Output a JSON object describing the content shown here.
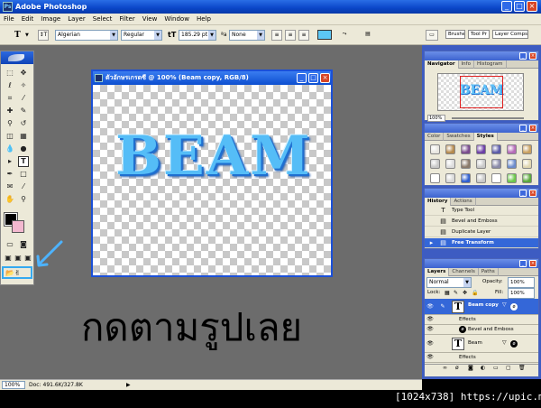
{
  "app": {
    "title": "Adobe Photoshop"
  },
  "menu": [
    "File",
    "Edit",
    "Image",
    "Layer",
    "Select",
    "Filter",
    "View",
    "Window",
    "Help"
  ],
  "options": {
    "tool_glyph": "T",
    "font_family": "Algerian",
    "font_style": "Regular",
    "font_size": "185.29 pt",
    "antialias": "None",
    "text_color": "#5cc7f6",
    "palette_wells": [
      "Brushes",
      "Tool Pr",
      "Layer Comps"
    ]
  },
  "document": {
    "title": "ตัวอักษรเกรดซี @ 100% (Beam copy, RGB/8)",
    "canvas_text": "BEAM"
  },
  "caption": "กดตามรูปเลย",
  "status": {
    "zoom": "100%",
    "doc": "Doc: 491.6K/327.8K",
    "arrow": "▶"
  },
  "navigator": {
    "tabs": [
      "Navigator",
      "Info",
      "Histogram"
    ],
    "thumb_text": "BEAM",
    "zoom": "100%"
  },
  "styles_panel": {
    "tabs": [
      "Color",
      "Swatches",
      "Styles"
    ],
    "swatch_colors": [
      "#e8e6e0",
      "#b58a4e",
      "#7a4b8e",
      "#6c3fa6",
      "#5b5ba8",
      "#b56bb8",
      "#c8a060",
      "#c8c8c8",
      "#dcdcdc",
      "#8a7a6a",
      "#c9c9c9",
      "#8a8aa8",
      "#6c8ccc",
      "#e0d6b0",
      "#ffffff",
      "#d8d8d8",
      "#2f5fd0",
      "#c8c8c8",
      "#ffffff",
      "#6cc84a",
      "#5aa83a"
    ]
  },
  "history": {
    "tabs": [
      "History",
      "Actions"
    ],
    "items": [
      {
        "label": "Type Tool",
        "icon": "T"
      },
      {
        "label": "Bevel and Emboss",
        "icon": "▤"
      },
      {
        "label": "Duplicate Layer",
        "icon": "▤"
      },
      {
        "label": "Free Transform",
        "icon": "▤"
      }
    ]
  },
  "layers": {
    "tabs": [
      "Layers",
      "Channels",
      "Paths"
    ],
    "blend_mode": "Normal",
    "opacity_label": "Opacity:",
    "opacity": "100%",
    "lock_label": "Lock:",
    "fill_label": "Fill:",
    "fill": "100%",
    "rows": [
      {
        "name": "Beam copy",
        "type": "text",
        "selected": true
      },
      {
        "name": "Effects",
        "type": "effects-header"
      },
      {
        "name": "Bevel and Emboss",
        "type": "effect"
      },
      {
        "name": "Beam",
        "type": "text",
        "selected": false
      },
      {
        "name": "Effects",
        "type": "effects-header"
      }
    ]
  },
  "watermark": "[1024x738] https://upic.me/"
}
